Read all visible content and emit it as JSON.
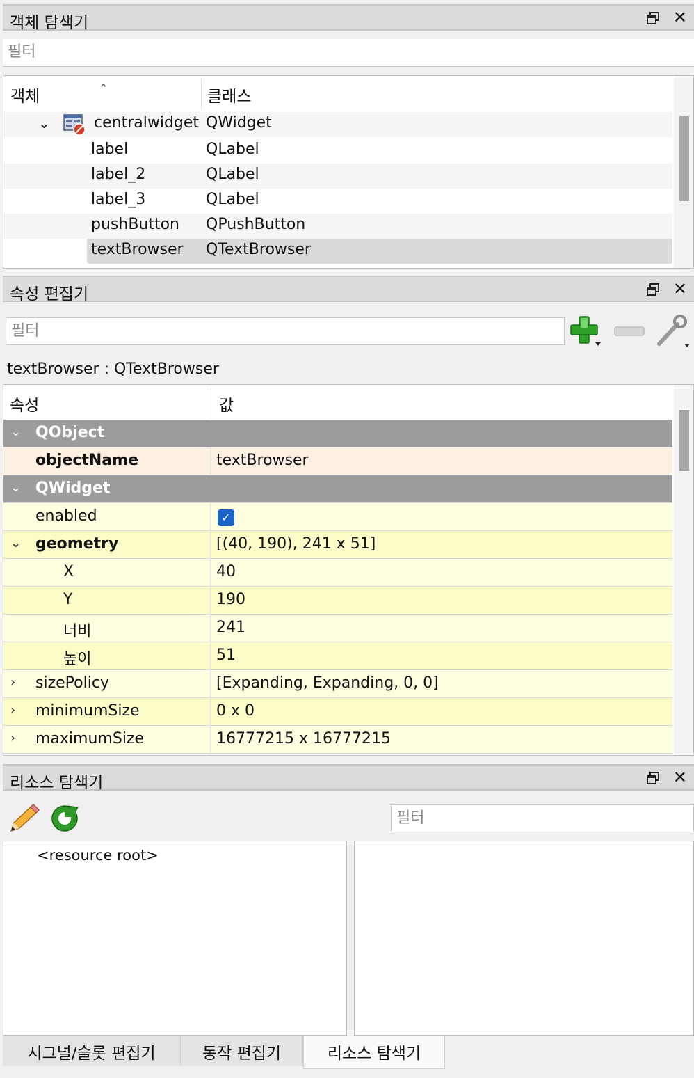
{
  "object_inspector": {
    "title": "객체 탐색기",
    "filter_placeholder": "필터",
    "columns": [
      "객체",
      "클래스"
    ],
    "rows": [
      {
        "name": "centralwidget",
        "class": "QWidget"
      },
      {
        "name": "label",
        "class": "QLabel"
      },
      {
        "name": "label_2",
        "class": "QLabel"
      },
      {
        "name": "label_3",
        "class": "QLabel"
      },
      {
        "name": "pushButton",
        "class": "QPushButton"
      },
      {
        "name": "textBrowser",
        "class": "QTextBrowser"
      }
    ]
  },
  "property_editor": {
    "title": "속성 편집기",
    "filter_placeholder": "필터",
    "object_label": "textBrowser : QTextBrowser",
    "columns": [
      "속성",
      "값"
    ],
    "groups": {
      "qobject": "QObject",
      "qwidget": "QWidget"
    },
    "props": {
      "objectName": {
        "name": "objectName",
        "value": "textBrowser"
      },
      "enabled": {
        "name": "enabled",
        "checked": true
      },
      "geometry": {
        "name": "geometry",
        "value": "[(40, 190), 241 x 51]"
      },
      "x": {
        "name": "X",
        "value": "40"
      },
      "y": {
        "name": "Y",
        "value": "190"
      },
      "width": {
        "name": "너비",
        "value": "241"
      },
      "height": {
        "name": "높이",
        "value": "51"
      },
      "sizePolicy": {
        "name": "sizePolicy",
        "value": "[Expanding, Expanding, 0, 0]"
      },
      "minimumSize": {
        "name": "minimumSize",
        "value": "0 x 0"
      },
      "maximumSize": {
        "name": "maximumSize",
        "value": "16777215 x 16777215"
      }
    }
  },
  "resource_browser": {
    "title": "리소스 탐색기",
    "filter_placeholder": "필터",
    "root": "<resource root>"
  },
  "tabs": [
    "시그널/슬롯 편집기",
    "동작 편집기",
    "리소스 탐색기"
  ],
  "icons": {
    "close": "✕",
    "float": "float-icon",
    "expand": "⌄",
    "collapsed": "›"
  }
}
